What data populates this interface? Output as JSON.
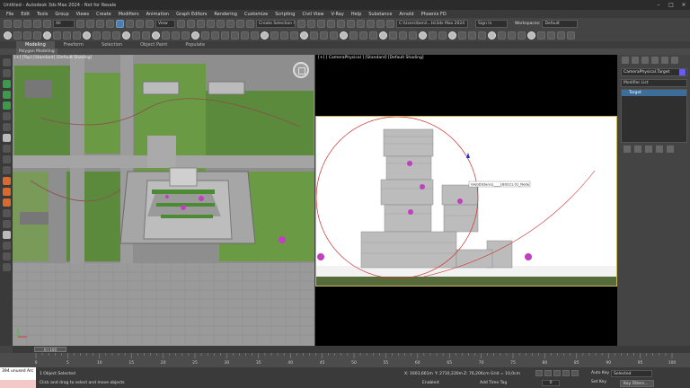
{
  "window": {
    "title": "Untitled - Autodesk 3ds Max 2024 - Not for Resale"
  },
  "menu": [
    "File",
    "Edit",
    "Tools",
    "Group",
    "Views",
    "Create",
    "Modifiers",
    "Animation",
    "Graph Editors",
    "Rendering",
    "Customize",
    "Scripting",
    "Civil View",
    "V-Ray",
    "Help",
    "Substance",
    "Arnold",
    "Phoenix FD"
  ],
  "top_right": {
    "path": "C:\\Users\\beni\\...ts\\3ds Max 2024",
    "signin": "Sign In",
    "workspaces_label": "Workspaces:",
    "workspace": "Default"
  },
  "toolbar": {
    "filter": "All",
    "refcoord": "View",
    "selection_set": "Create Selection Set"
  },
  "ribbon": {
    "tabs": [
      "Modeling",
      "Freeform",
      "Selection",
      "Object Paint",
      "Populate"
    ],
    "sub_label": "Polygon Modeling"
  },
  "viewport_top": {
    "label": "[+] [Top] [Standard] [Default Shading]"
  },
  "viewport_camera": {
    "label": "[+] [ CameraPhysical ] [Standard] [Default Shading]",
    "tooltip": "GlobDistance____LB0221.01_Node"
  },
  "command_panel": {
    "object_name": "CameraPhysical.Target",
    "modifier_list": "Modifier List",
    "stack_item": "Target"
  },
  "timeline": {
    "slider": "0 / 100",
    "ticks": [
      "0",
      "5",
      "10",
      "15",
      "20",
      "25",
      "30",
      "35",
      "40",
      "45",
      "50",
      "55",
      "60",
      "65",
      "70",
      "75",
      "80",
      "85",
      "90",
      "95",
      "100"
    ]
  },
  "status": {
    "maxscript": "394 unused Arc",
    "selected": "1 Object Selected",
    "prompt": "Click and drag to select and move objects",
    "x": "X: 1603,661m",
    "y": "Y: 2710,230m",
    "z": "Z: 76,206cm",
    "grid": "Grid = 10,0cm",
    "enabled": "Enabled:",
    "add_time_tag": "Add Time Tag",
    "frame": "0",
    "auto_key": "Auto Key",
    "set_key": "Set Key",
    "selected_mode": "Selected",
    "key_filters": "Key Filters..."
  }
}
